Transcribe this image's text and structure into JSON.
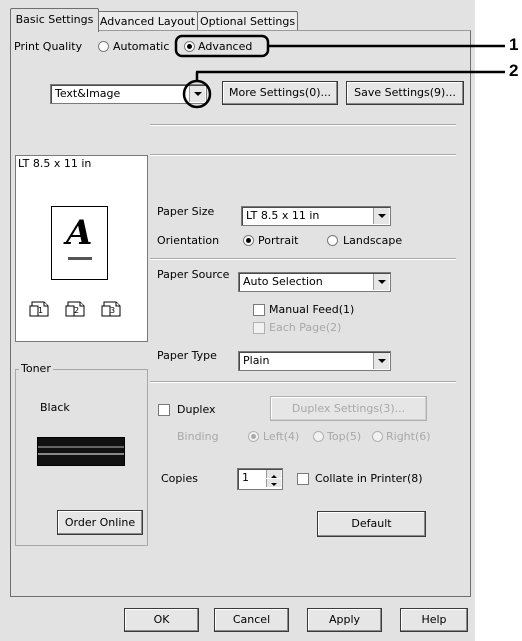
{
  "tabs": [
    {
      "label": "Basic Settings",
      "active": true
    },
    {
      "label": "Advanced Layout",
      "active": false
    },
    {
      "label": "Optional Settings",
      "active": false
    }
  ],
  "print_quality": {
    "label": "Print Quality",
    "options": [
      "Automatic",
      "Advanced"
    ],
    "selected": "Advanced"
  },
  "quality_preset": {
    "value": "Text&Image"
  },
  "buttons": {
    "more_settings": "More Settings(0)...",
    "save_settings": "Save Settings(9)...",
    "duplex_settings": "Duplex Settings(3)...",
    "order_online": "Order Online",
    "default": "Default",
    "ok": "OK",
    "cancel": "Cancel",
    "apply": "Apply",
    "help": "Help"
  },
  "preview": {
    "paper_label": "LT 8.5 x 11 in",
    "letter": "A"
  },
  "toner": {
    "legend": "Toner",
    "color_label": "Black"
  },
  "paper_size": {
    "label": "Paper Size",
    "value": "LT 8.5 x 11 in"
  },
  "orientation": {
    "label": "Orientation",
    "options": [
      "Portrait",
      "Landscape"
    ],
    "selected": "Portrait"
  },
  "paper_source": {
    "label": "Paper Source",
    "value": "Auto Selection",
    "manual_feed": "Manual Feed(1)",
    "each_page": "Each Page(2)"
  },
  "paper_type": {
    "label": "Paper Type",
    "value": "Plain"
  },
  "duplex": {
    "label": "Duplex",
    "binding_label": "Binding",
    "binding_options": [
      "Left(4)",
      "Top(5)",
      "Right(6)"
    ],
    "binding_selected": "Left(4)"
  },
  "copies": {
    "label": "Copies",
    "value": "1",
    "collate": "Collate in Printer(8)"
  },
  "callouts": [
    "1",
    "2"
  ],
  "colors": {
    "dialog_bg": "#e2e2e2",
    "callout": "#000000",
    "toner_bar": "#111111"
  }
}
